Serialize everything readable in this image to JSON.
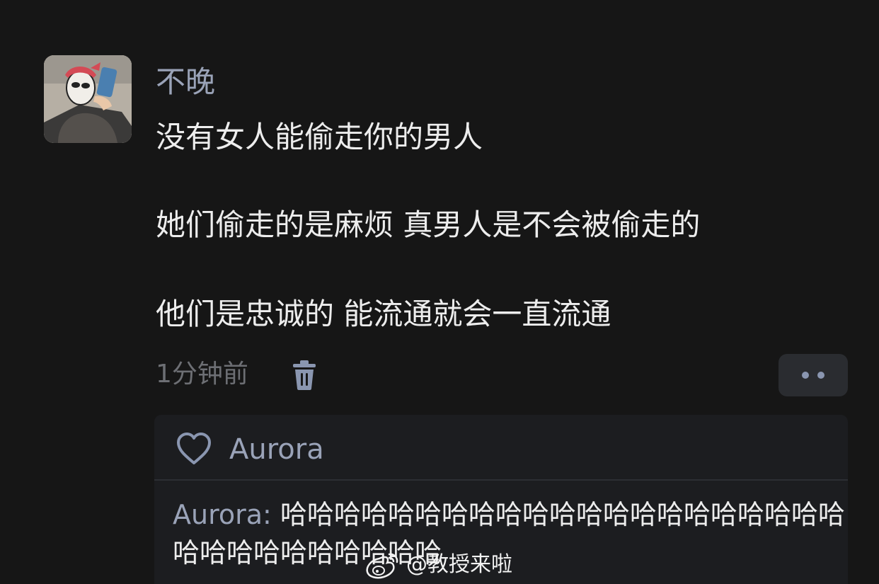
{
  "post": {
    "username": "不晚",
    "lines": [
      "没有女人能偷走你的男人",
      "她们偷走的是麻烦 真男人是不会被偷走的",
      "他们是忠诚的 能流通就会一直流通"
    ],
    "timestamp": "1分钟前",
    "delete_icon": "trash-icon",
    "more_icon": "dots-icon"
  },
  "likes": {
    "icon": "heart-icon",
    "names": "Aurora"
  },
  "reply": {
    "author": "Aurora:",
    "text": "哈哈哈哈哈哈哈哈哈哈哈哈哈哈哈哈哈哈哈哈哈哈哈哈哈哈哈哈哈哈哈"
  },
  "watermark": {
    "text": "@教授来啦",
    "logo": "weibo-logo"
  }
}
